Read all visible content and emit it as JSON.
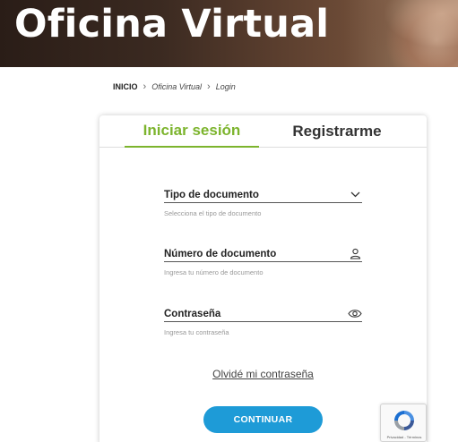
{
  "hero": {
    "title": "Oficina Virtual"
  },
  "breadcrumb": {
    "home": "INICIO",
    "separator": "›",
    "section": "Oficina Virtual",
    "current": "Login"
  },
  "tabs": {
    "login": "Iniciar sesión",
    "register": "Registrarme"
  },
  "form": {
    "document_type": {
      "label": "Tipo de documento",
      "hint": "Selecciona el tipo de documento",
      "icon": "chevron-down-icon"
    },
    "document_number": {
      "label": "Número de documento",
      "hint": "Ingresa tu número de documento",
      "icon": "user-icon"
    },
    "password": {
      "label": "Contraseña",
      "hint": "Ingresa tu contraseña",
      "icon": "eye-icon"
    },
    "forgot_password": "Olvidé mi contraseña",
    "continue_button": "CONTINUAR"
  },
  "recaptcha": {
    "legal": "Privacidad - Términos",
    "icon": "recaptcha-icon"
  },
  "colors": {
    "accent_green": "#7cb42d",
    "button_blue": "#1e9bd7"
  }
}
